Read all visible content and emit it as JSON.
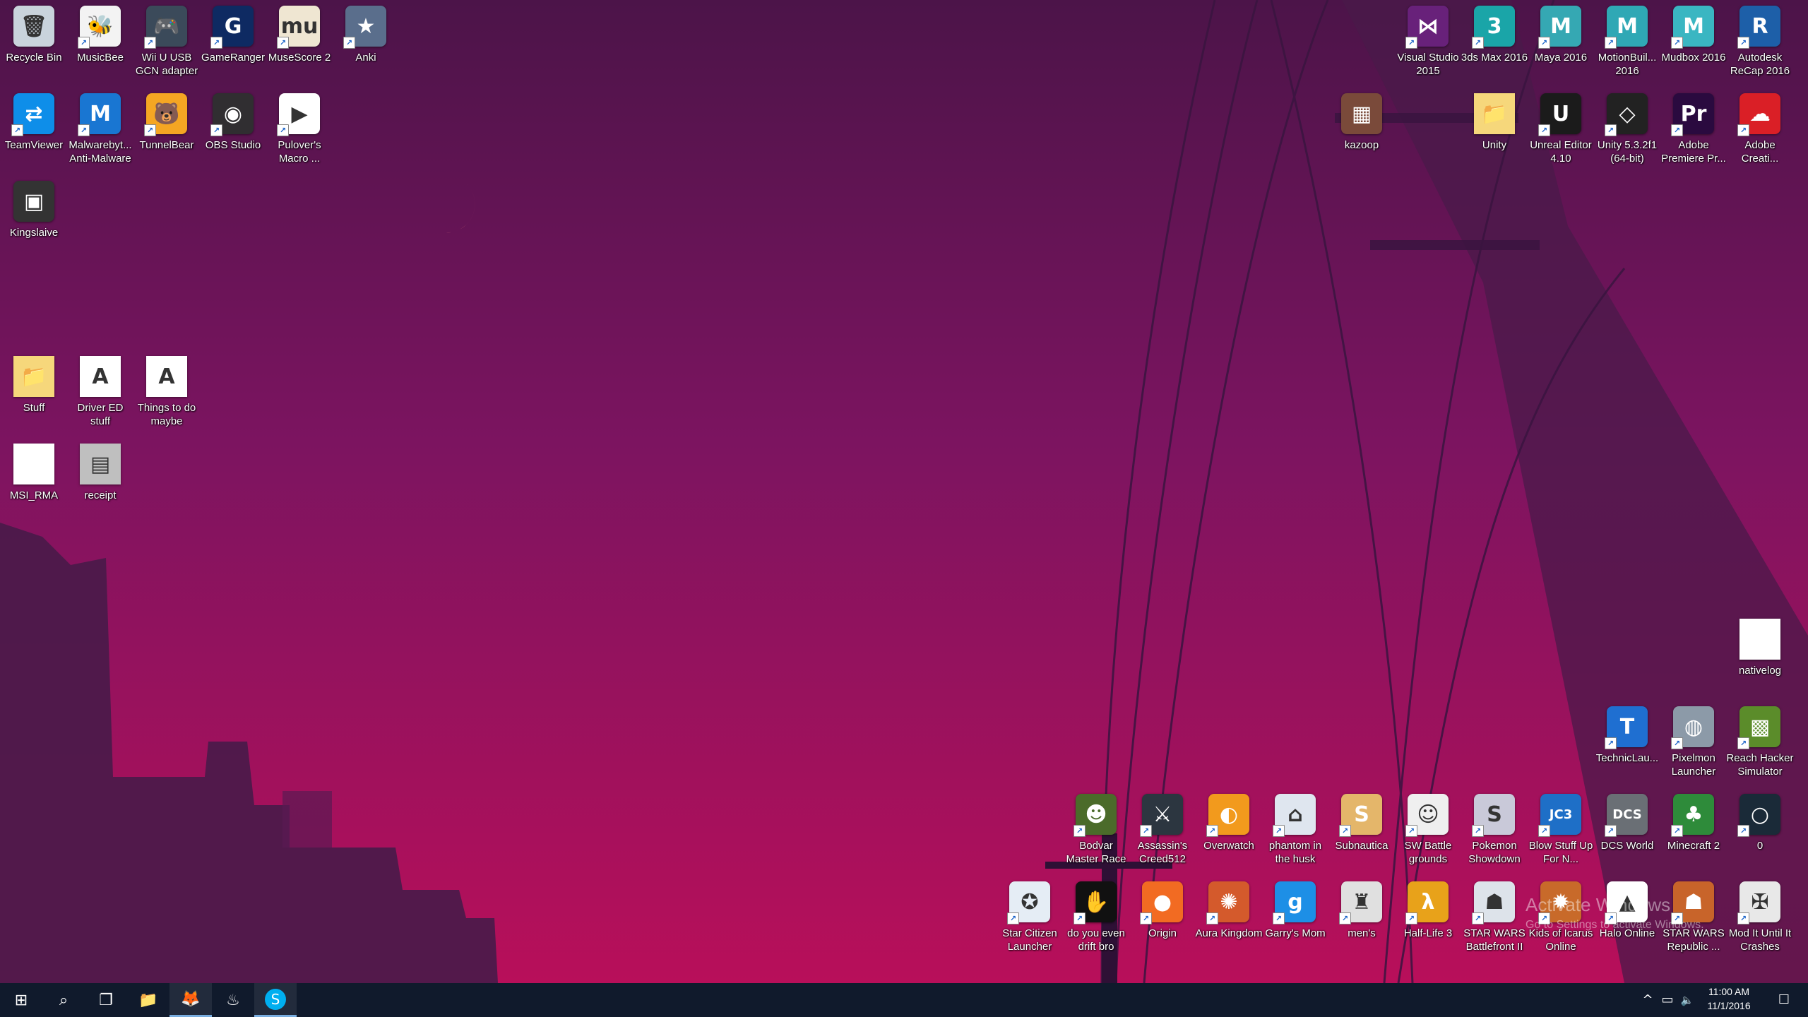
{
  "desktop": {
    "icons": [
      {
        "label": "Recycle Bin",
        "glyph": "🗑",
        "color": "#c9d3dc",
        "shortcut": false
      },
      {
        "label": "MusicBee",
        "glyph": "🐝",
        "color": "#f3f3f3",
        "shortcut": true
      },
      {
        "label": "Wii U USB GCN adapter",
        "glyph": "🎮",
        "color": "#3b4a5a",
        "shortcut": true
      },
      {
        "label": "GameRanger",
        "glyph": "G",
        "color": "#0e2a62",
        "shortcut": true
      },
      {
        "label": "MuseScore 2",
        "glyph": "mu",
        "color": "#efe6d2",
        "shortcut": true
      },
      {
        "label": "Anki",
        "glyph": "★",
        "color": "#5a6e8c",
        "shortcut": true
      },
      {
        "label": "TeamViewer",
        "glyph": "⇄",
        "color": "#0e8ee9",
        "shortcut": true
      },
      {
        "label": "Malwarebyt... Anti-Malware",
        "glyph": "M",
        "color": "#1976d2",
        "shortcut": true
      },
      {
        "label": "TunnelBear",
        "glyph": "🐻",
        "color": "#f5a623",
        "shortcut": true
      },
      {
        "label": "OBS Studio",
        "glyph": "◉",
        "color": "#302e31",
        "shortcut": true
      },
      {
        "label": "Pulover's Macro ...",
        "glyph": "▶",
        "color": "#ffffff",
        "shortcut": true
      },
      {
        "label": "Kingslaive",
        "glyph": "▣",
        "color": "#333333",
        "shortcut": false
      },
      {
        "label": "Stuff",
        "glyph": "📁",
        "color": "#f6d77b",
        "shortcut": false
      },
      {
        "label": "Driver ED stuff",
        "glyph": "A",
        "color": "#ffffff",
        "shortcut": false
      },
      {
        "label": "Things to do maybe",
        "glyph": "A",
        "color": "#ffffff",
        "shortcut": false
      },
      {
        "label": "MSI_RMA",
        "glyph": "",
        "color": "#ffffff",
        "shortcut": false
      },
      {
        "label": "receipt",
        "glyph": "▤",
        "color": "#bfbfbf",
        "shortcut": false
      },
      {
        "label": "Visual Studio 2015",
        "glyph": "⋈",
        "color": "#68217a",
        "shortcut": true
      },
      {
        "label": "3ds Max 2016",
        "glyph": "3",
        "color": "#1aa5a8",
        "shortcut": true
      },
      {
        "label": "Maya 2016",
        "glyph": "M",
        "color": "#35a8b3",
        "shortcut": true
      },
      {
        "label": "MotionBuil... 2016",
        "glyph": "M",
        "color": "#2fa8b5",
        "shortcut": true
      },
      {
        "label": "Mudbox 2016",
        "glyph": "M",
        "color": "#3ab6c2",
        "shortcut": true
      },
      {
        "label": "Autodesk ReCap 2016",
        "glyph": "R",
        "color": "#1d5fa8",
        "shortcut": true
      },
      {
        "label": "kazoop",
        "glyph": "▦",
        "color": "#7a4a3a",
        "shortcut": false
      },
      {
        "label": "Unity",
        "glyph": "📁",
        "color": "#f6d77b",
        "shortcut": false
      },
      {
        "label": "Unreal Editor 4.10",
        "glyph": "U",
        "color": "#1b1b1b",
        "shortcut": true
      },
      {
        "label": "Unity 5.3.2f1 (64-bit)",
        "glyph": "◇",
        "color": "#222222",
        "shortcut": true
      },
      {
        "label": "Adobe Premiere Pr...",
        "glyph": "Pr",
        "color": "#2a0a3f",
        "shortcut": true
      },
      {
        "label": "Adobe Creati...",
        "glyph": "☁",
        "color": "#da1f26",
        "shortcut": true
      },
      {
        "label": "nativelog",
        "glyph": "",
        "color": "#ffffff",
        "shortcut": false
      },
      {
        "label": "TechnicLau...",
        "glyph": "T",
        "color": "#1f6fd1",
        "shortcut": true
      },
      {
        "label": "Pixelmon Launcher",
        "glyph": "◍",
        "color": "#8c9aa8",
        "shortcut": true
      },
      {
        "label": "Reach Hacker Simulator",
        "glyph": "▩",
        "color": "#5b8c2a",
        "shortcut": true
      },
      {
        "label": "Bodvar Master Race",
        "glyph": "☻",
        "color": "#4b6b2a",
        "shortcut": true
      },
      {
        "label": "Assassin's Creed512",
        "glyph": "⚔",
        "color": "#2c3640",
        "shortcut": true
      },
      {
        "label": "Overwatch",
        "glyph": "◐",
        "color": "#f29a1d",
        "shortcut": true
      },
      {
        "label": "phantom in the husk",
        "glyph": "⌂",
        "color": "#dfe6ef",
        "shortcut": true
      },
      {
        "label": "Subnautica",
        "glyph": "S",
        "color": "#e4b66a",
        "shortcut": true
      },
      {
        "label": "SW Battle grounds",
        "glyph": "☺",
        "color": "#efefef",
        "shortcut": true
      },
      {
        "label": "Pokemon Showdown",
        "glyph": "S",
        "color": "#c9c9d9",
        "shortcut": true
      },
      {
        "label": "Blow Stuff Up For N...",
        "glyph": "JC3",
        "color": "#1e6fc7",
        "shortcut": true
      },
      {
        "label": "DCS World",
        "glyph": "DCS",
        "color": "#6a6f75",
        "shortcut": true
      },
      {
        "label": "Minecraft 2",
        "glyph": "♣",
        "color": "#2e8b3a",
        "shortcut": true
      },
      {
        "label": "0",
        "glyph": "○",
        "color": "#1a2a38",
        "shortcut": true
      },
      {
        "label": "Star Citizen Launcher",
        "glyph": "✪",
        "color": "#e5edf5",
        "shortcut": true
      },
      {
        "label": "do you even drift bro",
        "glyph": "✋",
        "color": "#111111",
        "shortcut": true
      },
      {
        "label": "Origin",
        "glyph": "●",
        "color": "#f26b22",
        "shortcut": true
      },
      {
        "label": "Aura Kingdom",
        "glyph": "✺",
        "color": "#d45a2c",
        "shortcut": true
      },
      {
        "label": "Garry's Mom",
        "glyph": "g",
        "color": "#1d8fe6",
        "shortcut": true
      },
      {
        "label": "men's",
        "glyph": "♜",
        "color": "#e0e0e0",
        "shortcut": true
      },
      {
        "label": "Half-Life 3",
        "glyph": "λ",
        "color": "#e8a21a",
        "shortcut": true
      },
      {
        "label": "STAR WARS Battlefront II",
        "glyph": "☗",
        "color": "#dde3ea",
        "shortcut": true
      },
      {
        "label": "Kids of Icarus Online",
        "glyph": "✹",
        "color": "#c86a2a",
        "shortcut": true
      },
      {
        "label": "Halo Online",
        "glyph": "▲",
        "color": "#ffffff",
        "shortcut": true
      },
      {
        "label": "STAR WARS Republic ...",
        "glyph": "☗",
        "color": "#c8642a",
        "shortcut": true
      },
      {
        "label": "Mod It Until It Crashes",
        "glyph": "✠",
        "color": "#e8e8e8",
        "shortcut": true
      }
    ]
  },
  "watermark": {
    "title": "Activate Windows",
    "subtitle": "Go to Settings to activate Windows."
  },
  "taskbar": {
    "start_glyph": "⊞",
    "search_glyph": "⌕",
    "taskview_glyph": "❐",
    "pinned": [
      {
        "name": "file-explorer",
        "glyph": "📁",
        "active": false
      },
      {
        "name": "firefox",
        "glyph": "🦊",
        "active": true
      },
      {
        "name": "steam",
        "glyph": "♨",
        "active": false
      },
      {
        "name": "skype",
        "glyph": "S",
        "active": true
      }
    ],
    "tray": {
      "chevron": "^",
      "network": "▭",
      "volume": "🔈",
      "notifications": "☐"
    },
    "clock": {
      "time": "11:00 AM",
      "date": "11/1/2016"
    }
  }
}
